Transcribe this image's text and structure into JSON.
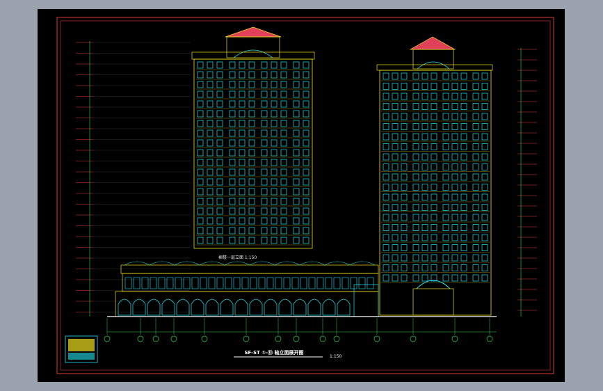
{
  "drawing": {
    "title_text": "SF-ST ①-⑬ 轴立面展开图",
    "scale_text": "1:150",
    "sub_label": "裙楼一层立面 1:150"
  },
  "colors": {
    "background": "#000000",
    "frame_red": "#e0383a",
    "window_cyan": "#26e3ef",
    "wall_yellow": "#f0e020",
    "dim_green": "#2fd94a",
    "roof_red": "#e0405a",
    "text_white": "#ffffff"
  }
}
